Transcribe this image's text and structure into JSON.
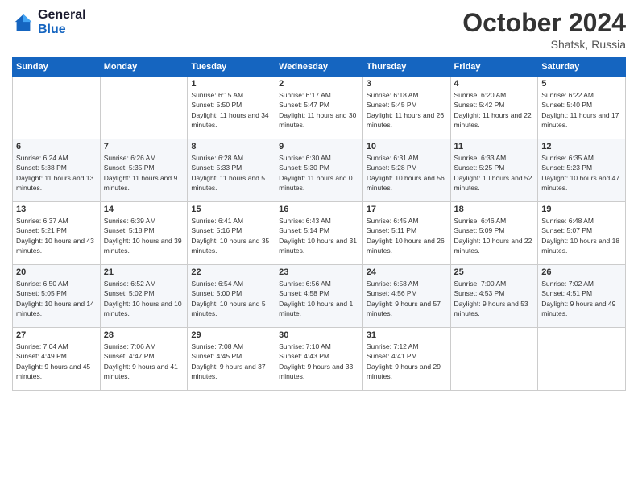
{
  "logo": {
    "line1": "General",
    "line2": "Blue"
  },
  "header": {
    "month": "October 2024",
    "location": "Shatsk, Russia"
  },
  "days_of_week": [
    "Sunday",
    "Monday",
    "Tuesday",
    "Wednesday",
    "Thursday",
    "Friday",
    "Saturday"
  ],
  "weeks": [
    [
      {
        "day": "",
        "sunrise": "",
        "sunset": "",
        "daylight": ""
      },
      {
        "day": "",
        "sunrise": "",
        "sunset": "",
        "daylight": ""
      },
      {
        "day": "1",
        "sunrise": "Sunrise: 6:15 AM",
        "sunset": "Sunset: 5:50 PM",
        "daylight": "Daylight: 11 hours and 34 minutes."
      },
      {
        "day": "2",
        "sunrise": "Sunrise: 6:17 AM",
        "sunset": "Sunset: 5:47 PM",
        "daylight": "Daylight: 11 hours and 30 minutes."
      },
      {
        "day": "3",
        "sunrise": "Sunrise: 6:18 AM",
        "sunset": "Sunset: 5:45 PM",
        "daylight": "Daylight: 11 hours and 26 minutes."
      },
      {
        "day": "4",
        "sunrise": "Sunrise: 6:20 AM",
        "sunset": "Sunset: 5:42 PM",
        "daylight": "Daylight: 11 hours and 22 minutes."
      },
      {
        "day": "5",
        "sunrise": "Sunrise: 6:22 AM",
        "sunset": "Sunset: 5:40 PM",
        "daylight": "Daylight: 11 hours and 17 minutes."
      }
    ],
    [
      {
        "day": "6",
        "sunrise": "Sunrise: 6:24 AM",
        "sunset": "Sunset: 5:38 PM",
        "daylight": "Daylight: 11 hours and 13 minutes."
      },
      {
        "day": "7",
        "sunrise": "Sunrise: 6:26 AM",
        "sunset": "Sunset: 5:35 PM",
        "daylight": "Daylight: 11 hours and 9 minutes."
      },
      {
        "day": "8",
        "sunrise": "Sunrise: 6:28 AM",
        "sunset": "Sunset: 5:33 PM",
        "daylight": "Daylight: 11 hours and 5 minutes."
      },
      {
        "day": "9",
        "sunrise": "Sunrise: 6:30 AM",
        "sunset": "Sunset: 5:30 PM",
        "daylight": "Daylight: 11 hours and 0 minutes."
      },
      {
        "day": "10",
        "sunrise": "Sunrise: 6:31 AM",
        "sunset": "Sunset: 5:28 PM",
        "daylight": "Daylight: 10 hours and 56 minutes."
      },
      {
        "day": "11",
        "sunrise": "Sunrise: 6:33 AM",
        "sunset": "Sunset: 5:25 PM",
        "daylight": "Daylight: 10 hours and 52 minutes."
      },
      {
        "day": "12",
        "sunrise": "Sunrise: 6:35 AM",
        "sunset": "Sunset: 5:23 PM",
        "daylight": "Daylight: 10 hours and 47 minutes."
      }
    ],
    [
      {
        "day": "13",
        "sunrise": "Sunrise: 6:37 AM",
        "sunset": "Sunset: 5:21 PM",
        "daylight": "Daylight: 10 hours and 43 minutes."
      },
      {
        "day": "14",
        "sunrise": "Sunrise: 6:39 AM",
        "sunset": "Sunset: 5:18 PM",
        "daylight": "Daylight: 10 hours and 39 minutes."
      },
      {
        "day": "15",
        "sunrise": "Sunrise: 6:41 AM",
        "sunset": "Sunset: 5:16 PM",
        "daylight": "Daylight: 10 hours and 35 minutes."
      },
      {
        "day": "16",
        "sunrise": "Sunrise: 6:43 AM",
        "sunset": "Sunset: 5:14 PM",
        "daylight": "Daylight: 10 hours and 31 minutes."
      },
      {
        "day": "17",
        "sunrise": "Sunrise: 6:45 AM",
        "sunset": "Sunset: 5:11 PM",
        "daylight": "Daylight: 10 hours and 26 minutes."
      },
      {
        "day": "18",
        "sunrise": "Sunrise: 6:46 AM",
        "sunset": "Sunset: 5:09 PM",
        "daylight": "Daylight: 10 hours and 22 minutes."
      },
      {
        "day": "19",
        "sunrise": "Sunrise: 6:48 AM",
        "sunset": "Sunset: 5:07 PM",
        "daylight": "Daylight: 10 hours and 18 minutes."
      }
    ],
    [
      {
        "day": "20",
        "sunrise": "Sunrise: 6:50 AM",
        "sunset": "Sunset: 5:05 PM",
        "daylight": "Daylight: 10 hours and 14 minutes."
      },
      {
        "day": "21",
        "sunrise": "Sunrise: 6:52 AM",
        "sunset": "Sunset: 5:02 PM",
        "daylight": "Daylight: 10 hours and 10 minutes."
      },
      {
        "day": "22",
        "sunrise": "Sunrise: 6:54 AM",
        "sunset": "Sunset: 5:00 PM",
        "daylight": "Daylight: 10 hours and 5 minutes."
      },
      {
        "day": "23",
        "sunrise": "Sunrise: 6:56 AM",
        "sunset": "Sunset: 4:58 PM",
        "daylight": "Daylight: 10 hours and 1 minute."
      },
      {
        "day": "24",
        "sunrise": "Sunrise: 6:58 AM",
        "sunset": "Sunset: 4:56 PM",
        "daylight": "Daylight: 9 hours and 57 minutes."
      },
      {
        "day": "25",
        "sunrise": "Sunrise: 7:00 AM",
        "sunset": "Sunset: 4:53 PM",
        "daylight": "Daylight: 9 hours and 53 minutes."
      },
      {
        "day": "26",
        "sunrise": "Sunrise: 7:02 AM",
        "sunset": "Sunset: 4:51 PM",
        "daylight": "Daylight: 9 hours and 49 minutes."
      }
    ],
    [
      {
        "day": "27",
        "sunrise": "Sunrise: 7:04 AM",
        "sunset": "Sunset: 4:49 PM",
        "daylight": "Daylight: 9 hours and 45 minutes."
      },
      {
        "day": "28",
        "sunrise": "Sunrise: 7:06 AM",
        "sunset": "Sunset: 4:47 PM",
        "daylight": "Daylight: 9 hours and 41 minutes."
      },
      {
        "day": "29",
        "sunrise": "Sunrise: 7:08 AM",
        "sunset": "Sunset: 4:45 PM",
        "daylight": "Daylight: 9 hours and 37 minutes."
      },
      {
        "day": "30",
        "sunrise": "Sunrise: 7:10 AM",
        "sunset": "Sunset: 4:43 PM",
        "daylight": "Daylight: 9 hours and 33 minutes."
      },
      {
        "day": "31",
        "sunrise": "Sunrise: 7:12 AM",
        "sunset": "Sunset: 4:41 PM",
        "daylight": "Daylight: 9 hours and 29 minutes."
      },
      {
        "day": "",
        "sunrise": "",
        "sunset": "",
        "daylight": ""
      },
      {
        "day": "",
        "sunrise": "",
        "sunset": "",
        "daylight": ""
      }
    ]
  ]
}
